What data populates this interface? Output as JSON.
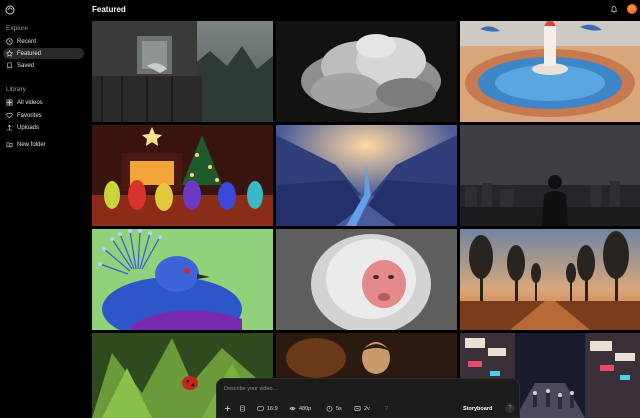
{
  "sidebar": {
    "explore_title": "Explore",
    "explore_items": [
      {
        "label": "Recent",
        "icon": "clock-icon",
        "active": false
      },
      {
        "label": "Featured",
        "icon": "star-icon",
        "active": true
      },
      {
        "label": "Saved",
        "icon": "bookmark-icon",
        "active": false
      }
    ],
    "library_title": "Library",
    "library_items": [
      {
        "label": "All videos",
        "icon": "grid-icon"
      },
      {
        "label": "Favorites",
        "icon": "heart-icon"
      },
      {
        "label": "Uploads",
        "icon": "upload-icon"
      }
    ],
    "new_folder": {
      "label": "New folder",
      "icon": "add-folder-icon"
    }
  },
  "header": {
    "title": "Featured"
  },
  "gallery": [
    {
      "name": "abandoned-house-porch"
    },
    {
      "name": "storm-cloud"
    },
    {
      "name": "clay-rocket-pool"
    },
    {
      "name": "christmas-toys"
    },
    {
      "name": "paper-wings-river"
    },
    {
      "name": "city-skyline-silhouette"
    },
    {
      "name": "crowned-pigeon"
    },
    {
      "name": "snow-monkey"
    },
    {
      "name": "tree-lined-road-sunset"
    },
    {
      "name": "ladybug-leaf"
    },
    {
      "name": "candlelit-portrait"
    },
    {
      "name": "neon-street-market"
    }
  ],
  "composer": {
    "placeholder": "Describe your video...",
    "aspect": "16:9",
    "resolution": "480p",
    "duration": "5s",
    "variations": "2v",
    "help": "?",
    "storyboard": "Storyboard",
    "more": "?"
  }
}
